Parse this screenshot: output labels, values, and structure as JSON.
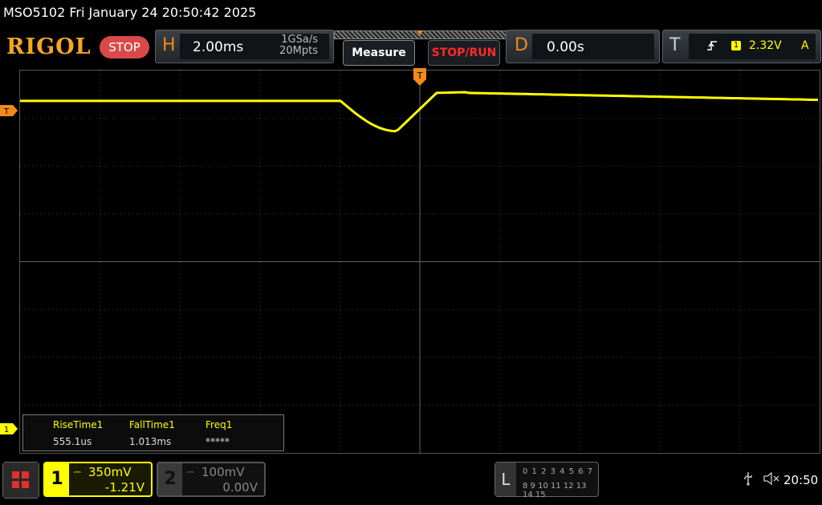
{
  "title_bar": {
    "text": "MSO5102  Fri January 24 20:50:42 2025"
  },
  "header": {
    "logo": "RIGOL",
    "run_state": "STOP",
    "horizontal": {
      "letter": "H",
      "timebase": "2.00ms",
      "sample_rate": "1GSa/s",
      "memory_depth": "20Mpts"
    },
    "measure_button": "Measure",
    "stoprun_button": "STOP/RUN",
    "delay": {
      "letter": "D",
      "value": "0.00s"
    },
    "trigger": {
      "letter": "T",
      "edge_icon": "rising-edge-icon",
      "source": "1",
      "level": "2.32V",
      "mode": "A"
    }
  },
  "markers": {
    "trigger_position": "T",
    "trigger_level": "T",
    "ch1_offset": "1"
  },
  "measurements": [
    {
      "name": "RiseTime1",
      "value": "555.1us"
    },
    {
      "name": "FallTime1",
      "value": "1.013ms"
    },
    {
      "name": "Freq1",
      "value": "*****"
    }
  ],
  "channels": [
    {
      "number": "1",
      "coupling_icon": "dc-coupling-icon",
      "scale": "350mV",
      "offset": "-1.21V",
      "active": true,
      "color": "#ffff00"
    },
    {
      "number": "2",
      "coupling_icon": "dc-coupling-icon",
      "scale": "100mV",
      "offset": "0.00V",
      "active": false,
      "color": "#888888"
    }
  ],
  "logic_analyzer": {
    "letter": "L",
    "row1": "0 1 2 3   4 5 6 7",
    "row2": "8 9 10 11 12 13 14 15"
  },
  "status": {
    "clock": "20:50"
  },
  "colors": {
    "accent": "#ef8a1b",
    "trace": "#ffff00",
    "stop": "#d84a4a",
    "stoprun_text": "#ff2a2a"
  }
}
